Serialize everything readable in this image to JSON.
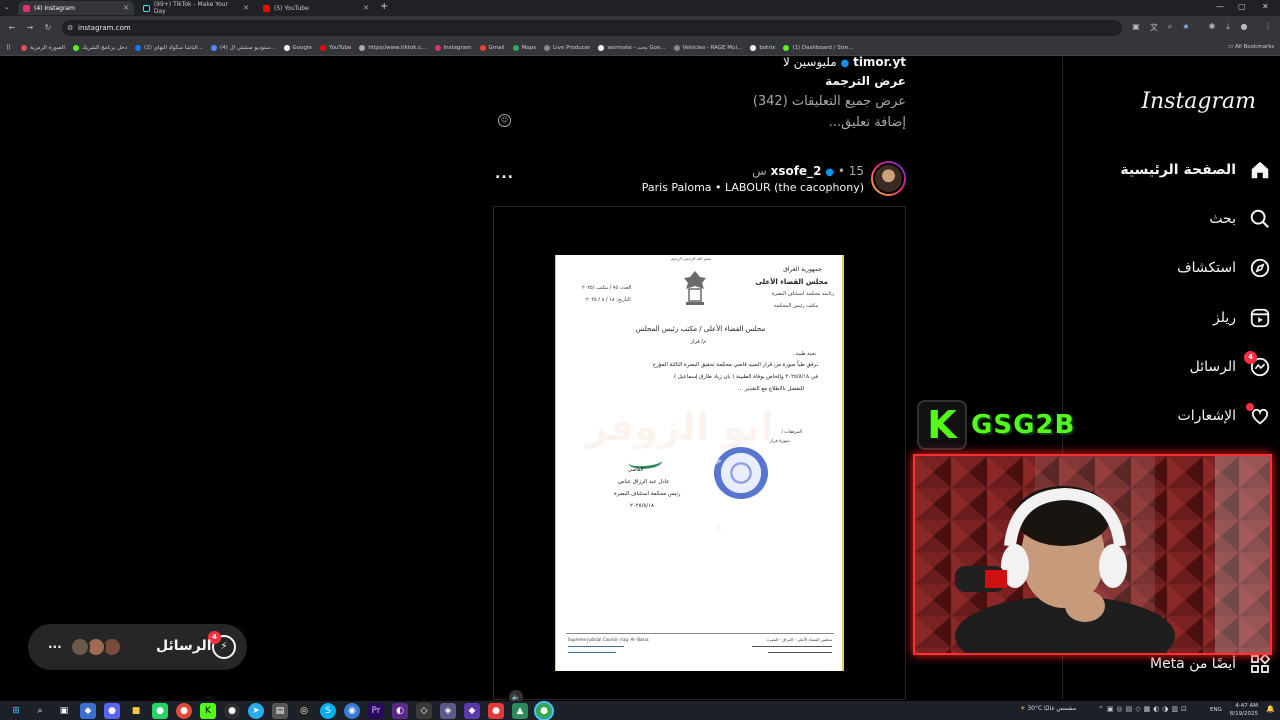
{
  "browser": {
    "tabs": [
      {
        "title": "(4) Instagram",
        "active": true,
        "color": "#e1306c"
      },
      {
        "title": "(99+) TikTok - Make Your Day",
        "active": false,
        "color": "#111111"
      },
      {
        "title": "(5) YouTube",
        "active": false,
        "color": "#ff0000"
      }
    ],
    "new_tab": "+",
    "url": "instagram.com",
    "bookmarks": [
      {
        "label": "الصورة الرمزية",
        "color": "#d9534f"
      },
      {
        "label": "دخل برنامج الشريك",
        "color": "#53fc18"
      },
      {
        "label": "(2) الباشا سكواد النهاي...",
        "color": "#1877f2"
      },
      {
        "label": "(4) ستوديو منشئي ال...",
        "color": "#4a8cff"
      },
      {
        "label": "Google",
        "color": "#ffffff"
      },
      {
        "label": "YouTube",
        "color": "#ff0000"
      },
      {
        "label": "https//www.tiktok.c...",
        "color": "#aaaaaa"
      },
      {
        "label": "Instagram",
        "color": "#e1306c"
      },
      {
        "label": "Gmail",
        "color": "#ea4335"
      },
      {
        "label": "Maps",
        "color": "#34a853"
      },
      {
        "label": "Live Producer",
        "color": "#888888"
      },
      {
        "label": "wormate - بحث Goo...",
        "color": "#ffffff"
      },
      {
        "label": "Vehicles - RAGE Mul...",
        "color": "#888888"
      },
      {
        "label": "botrix",
        "color": "#ffffff"
      },
      {
        "label": "(1) Dashboard / Stre...",
        "color": "#53fc18"
      }
    ],
    "all_bookmarks": "All Bookmarks"
  },
  "sidebar": {
    "logo": "Instagram",
    "items": [
      {
        "label": "الصفحة الرئيسية",
        "icon": "home-icon",
        "bold": true
      },
      {
        "label": "بحث",
        "icon": "search-icon"
      },
      {
        "label": "استكشاف",
        "icon": "explore-icon"
      },
      {
        "label": "ريلز",
        "icon": "reels-icon"
      },
      {
        "label": "الرسائل",
        "icon": "messenger-icon",
        "badge": "4"
      },
      {
        "label": "الإشعارات",
        "icon": "heart-icon"
      }
    ],
    "meta": "أيضًا من Meta"
  },
  "prev_post": {
    "username": "timor.yt",
    "caption_tail": "مليوسين لا",
    "see_translation": "عرض الترجمة",
    "view_comments": "عرض جميع التعليقات (342)",
    "add_comment": "إضافة تعليق..."
  },
  "post": {
    "username": "xsofe_2",
    "time": "15 س",
    "separator": "•",
    "audio": "Paris Paloma • LABOUR (the cacophony)",
    "more": "..."
  },
  "document": {
    "basmala": "بسم الله الرحمن الرحيم",
    "country": "جمهورية العراق",
    "council": "مجلس القضاء الأعلى",
    "court": "رئاسة محكمة استئناف البصرة",
    "office": "مكتب رئيس المحكمة",
    "number": "العدد: ٩٥ / مكتب /٢٠٢٥",
    "date": "التاريخ: ١٨ / ٨ / ٢٠٢٥",
    "recipient": "مجلس القضاء الأعلى / مكتب رئيس المجلس",
    "subject": "م/ قرار",
    "greeting": "تحية طيبة..",
    "body1": "نرفق طياً صورة من قرار السيد قاضي محكمة تحقيق البصرة الثالثة المؤرخ",
    "body2": "في ٢٠٢٥/٨/١٨ والخاص بوفاة الطبيبة ( بان زياد طارق إسماعيل )",
    "body3": "للتفضل بالاطلاع مع التقدير ...",
    "attachments": "المرفقات /",
    "attach_item": "صورة قرار",
    "judge_title": "القاضي",
    "judge_name": "عادل عبد الرزاق عباس",
    "judge_role": "رئيس محكمة استئناف البصرة",
    "sign_date": "٢٠٢٥/٨/١٨",
    "footer_left": "Supreme Judicial Council- Iraq -Al- Basra",
    "footer_right": "مجلس القضاء الأعلى - العراق - البصرة"
  },
  "messages_pill": {
    "label": "الرسائل",
    "badge": "4",
    "more": "..."
  },
  "overlay": {
    "letter": "K",
    "tag": "GSG2B",
    "kick_color": "#53fc18"
  },
  "taskbar": {
    "weather": "30°C مشمس غالبًا",
    "lang": "ENG",
    "time": "4:47 AM",
    "date": "8/19/2025"
  }
}
